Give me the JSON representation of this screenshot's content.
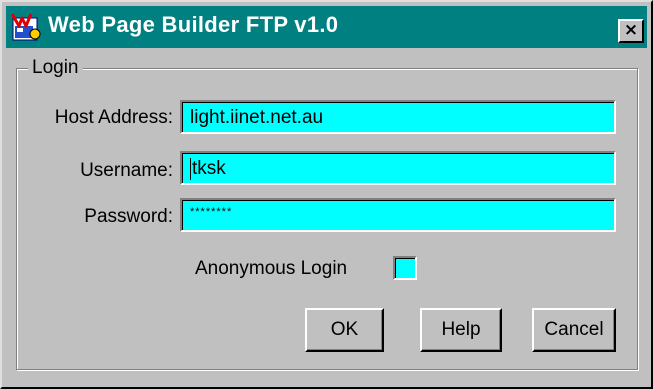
{
  "window": {
    "title": "Web Page Builder FTP v1.0",
    "close_glyph": "×",
    "icon": "web-page-builder-icon"
  },
  "group": {
    "label": "Login"
  },
  "fields": {
    "host": {
      "label": "Host Address:",
      "value": "light.iinet.net.au"
    },
    "username": {
      "label": "Username:",
      "value": "tksk"
    },
    "password": {
      "label": "Password:",
      "value": "********"
    }
  },
  "anonymous": {
    "label": "Anonymous Login",
    "checked": false
  },
  "buttons": {
    "ok": "OK",
    "help": "Help",
    "cancel": "Cancel"
  },
  "colors": {
    "titlebar": "#008080",
    "field_bg": "#00ffff",
    "window_bg": "#c0c0c0"
  }
}
